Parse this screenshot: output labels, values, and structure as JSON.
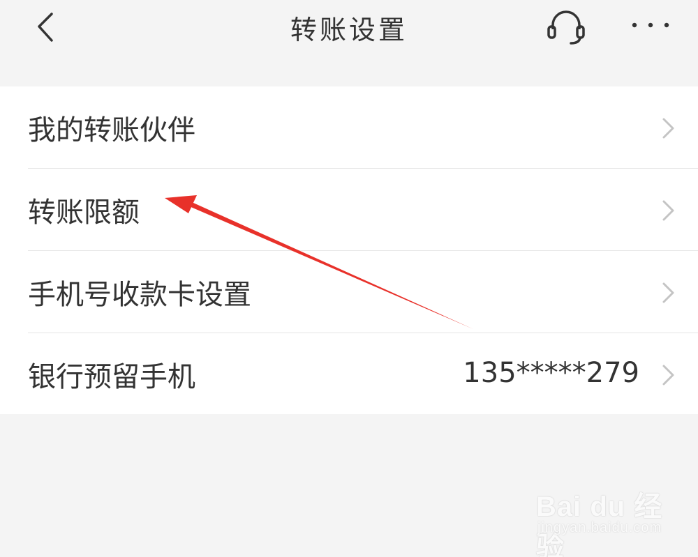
{
  "header": {
    "title": "转账设置",
    "back_icon": "chevron-left-icon",
    "support_icon": "headset-icon",
    "more_icon": "more-dots-icon"
  },
  "settings": {
    "items": [
      {
        "label": "我的转账伙伴",
        "value": ""
      },
      {
        "label": "转账限额",
        "value": ""
      },
      {
        "label": "手机号收款卡设置",
        "value": ""
      },
      {
        "label": "银行预留手机",
        "value": "135*****279"
      }
    ]
  },
  "annotation": {
    "color": "#e8312a"
  },
  "watermark": {
    "main": "Bai du 经验",
    "sub": "jingyan.baidu.com"
  },
  "colors": {
    "background": "#f4f4f4",
    "card": "#ffffff",
    "text": "#333333",
    "chevron": "#c4c4c4"
  }
}
